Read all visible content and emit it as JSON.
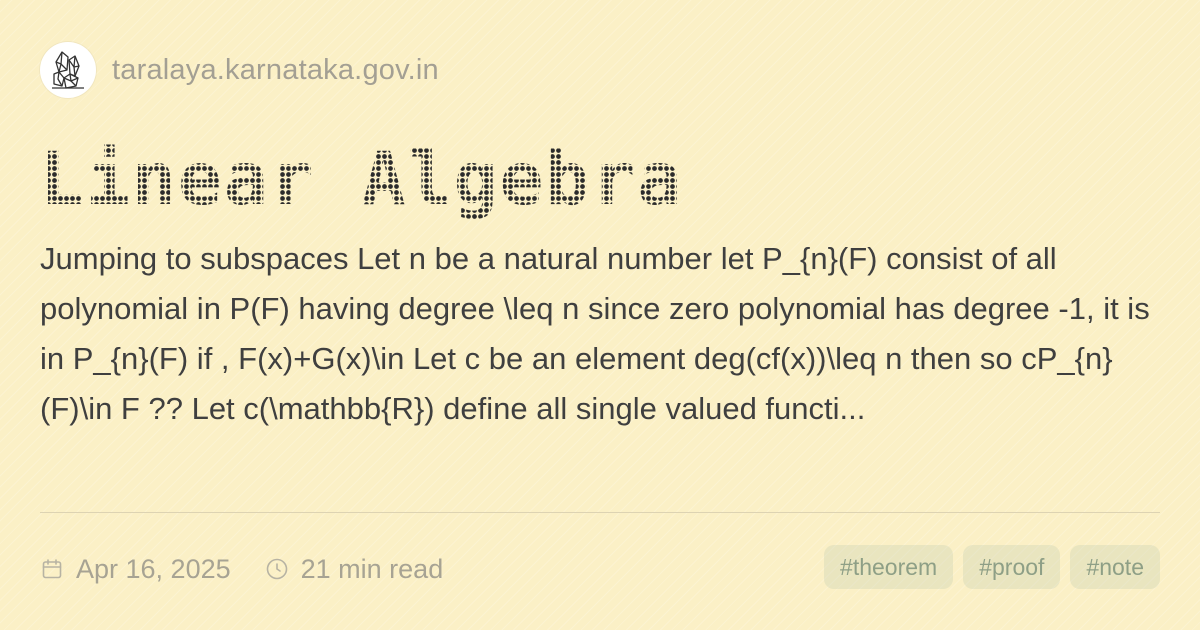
{
  "site": {
    "domain": "taralaya.karnataka.gov.in",
    "icon": "crystal-icon"
  },
  "post": {
    "title": "Linear Algebra",
    "description": "Jumping to subspaces Let n be a natural number let P_{n}(F) consist of all polynomial in P(F) having degree \\leq n since zero polynomial has degree -1, it is in P_{n}(F) if , F(x)+G(x)\\in Let c be an element deg(cf(x))\\leq n then so cP_{n}(F)\\in F ?? Let c(\\mathbb{R}) define all single valued functi..."
  },
  "meta": {
    "date": "Apr 16, 2025",
    "date_icon": "calendar-icon",
    "read_time": "21 min read",
    "read_time_icon": "clock-icon"
  },
  "tags": [
    "#theorem",
    "#proof",
    "#note"
  ],
  "colors": {
    "background": "#fbf0c6",
    "title": "#2b2b2b",
    "body_text": "#3f3f3f",
    "muted_text": "#a7a393",
    "tag_text": "#8e9f86"
  }
}
